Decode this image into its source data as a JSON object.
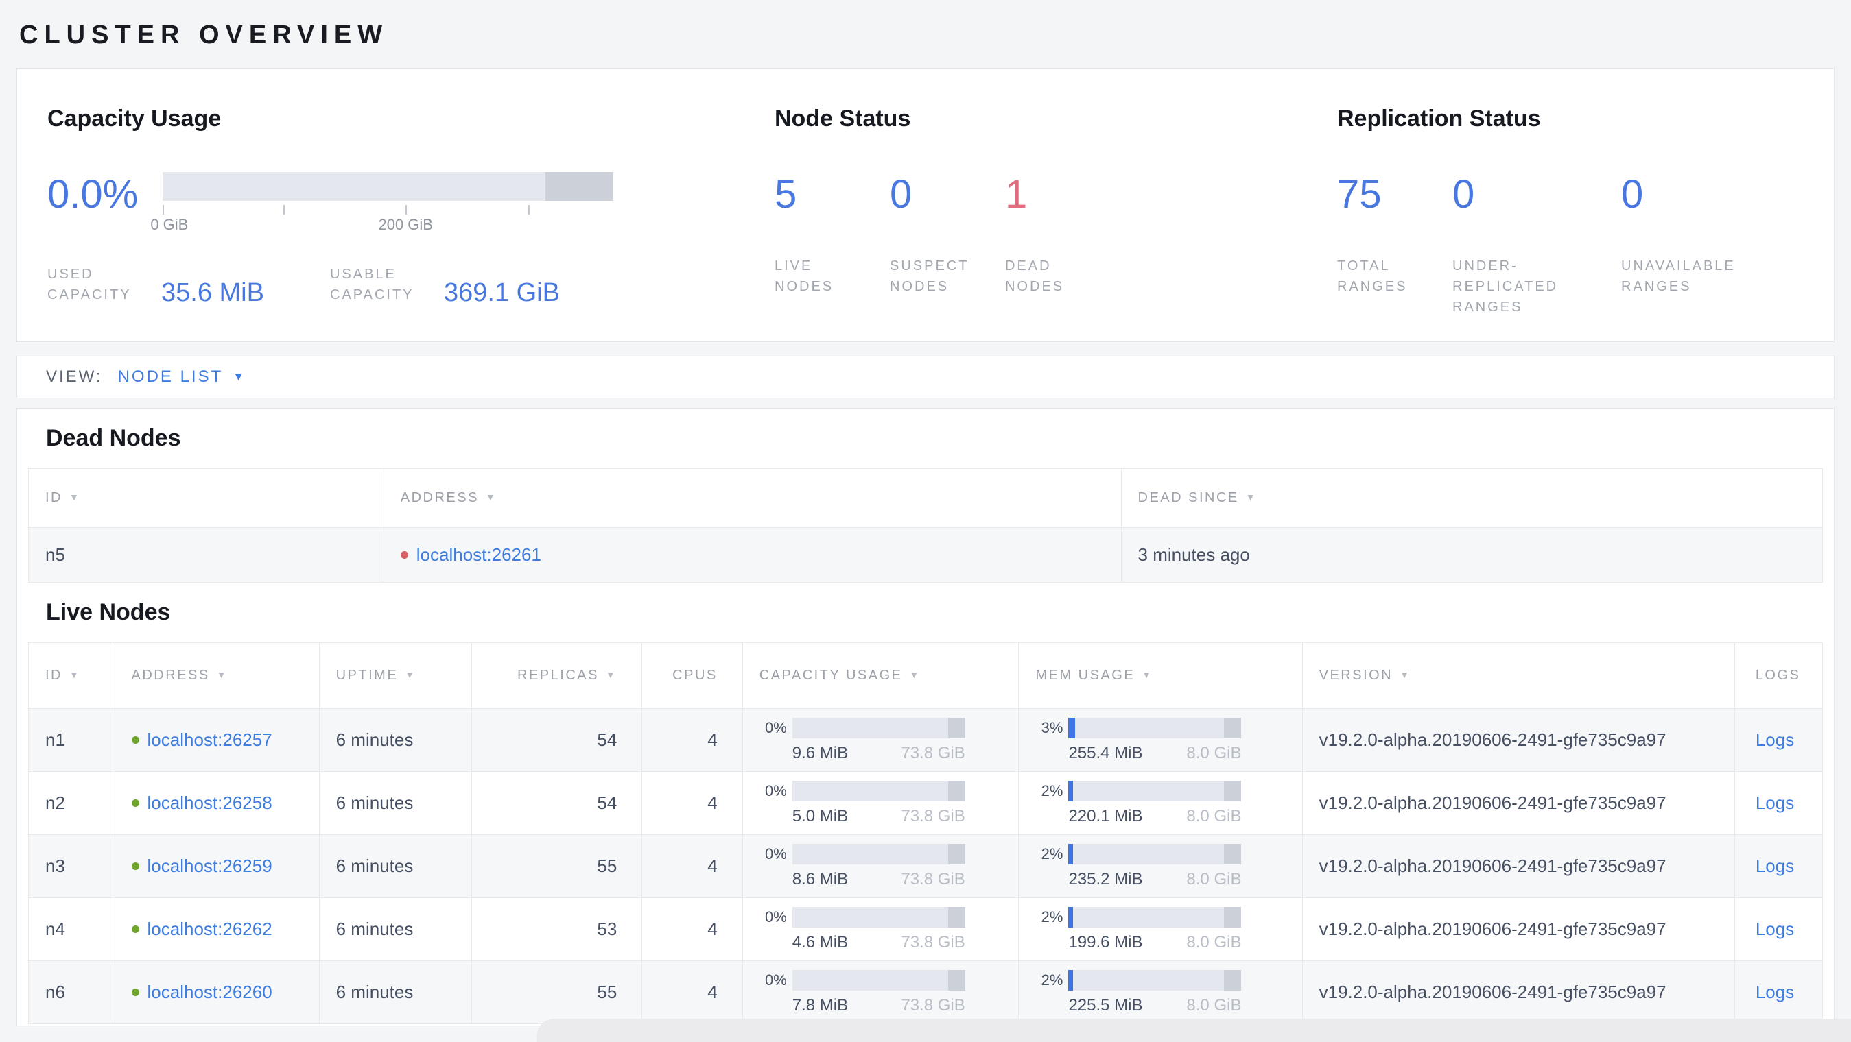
{
  "page": {
    "title": "CLUSTER OVERVIEW"
  },
  "colors": {
    "accent_blue": "#4878df",
    "link_blue": "#3e7ce0",
    "danger_red": "#e06c7d",
    "green_dot": "#6fa42d",
    "red_dot": "#d65d63",
    "bar_track": "#e4e7ed",
    "bar_dark_segment": "#ccd0d9",
    "bar_fill_blue": "#3f74e6"
  },
  "icons": {
    "sort_desc": "▼",
    "caret_down": "▼"
  },
  "summary": {
    "capacity": {
      "title": "Capacity Usage",
      "percent": "0.0%",
      "tick_labels": [
        "0 GiB",
        "200 GiB"
      ],
      "stats": [
        {
          "label": "USED CAPACITY",
          "value": "35.6 MiB"
        },
        {
          "label": "USABLE CAPACITY",
          "value": "369.1 GiB"
        }
      ]
    },
    "node_status": {
      "title": "Node Status",
      "stats": [
        {
          "value": "5",
          "label": "LIVE NODES"
        },
        {
          "value": "0",
          "label": "SUSPECT NODES"
        },
        {
          "value": "1",
          "label": "DEAD NODES"
        }
      ]
    },
    "replication": {
      "title": "Replication Status",
      "stats": [
        {
          "value": "75",
          "label": "TOTAL RANGES"
        },
        {
          "value": "0",
          "label": "UNDER-REPLICATED RANGES"
        },
        {
          "value": "0",
          "label": "UNAVAILABLE RANGES"
        }
      ]
    }
  },
  "view_bar": {
    "label": "VIEW:",
    "selected": "NODE LIST"
  },
  "dead_nodes": {
    "title": "Dead Nodes",
    "columns": [
      {
        "label": "ID"
      },
      {
        "label": "ADDRESS"
      },
      {
        "label": "DEAD SINCE"
      }
    ],
    "rows": [
      {
        "id": "n5",
        "address": "localhost:26261",
        "dead_since": "3 minutes ago"
      }
    ]
  },
  "live_nodes": {
    "title": "Live Nodes",
    "columns": [
      {
        "label": "ID"
      },
      {
        "label": "ADDRESS"
      },
      {
        "label": "UPTIME"
      },
      {
        "label": "REPLICAS"
      },
      {
        "label": "CPUS"
      },
      {
        "label": "CAPACITY USAGE"
      },
      {
        "label": "MEM USAGE"
      },
      {
        "label": "VERSION"
      },
      {
        "label": "LOGS"
      }
    ],
    "rows": [
      {
        "id": "n1",
        "address": "localhost:26257",
        "uptime": "6 minutes",
        "replicas": "54",
        "cpus": "4",
        "cap": {
          "pct": "0%",
          "used": "9.6 MiB",
          "total": "73.8 GiB"
        },
        "mem": {
          "pct": "3%",
          "used": "255.4 MiB",
          "total": "8.0 GiB"
        },
        "version": "v19.2.0-alpha.20190606-2491-gfe735c9a97",
        "logs_label": "Logs"
      },
      {
        "id": "n2",
        "address": "localhost:26258",
        "uptime": "6 minutes",
        "replicas": "54",
        "cpus": "4",
        "cap": {
          "pct": "0%",
          "used": "5.0 MiB",
          "total": "73.8 GiB"
        },
        "mem": {
          "pct": "2%",
          "used": "220.1 MiB",
          "total": "8.0 GiB"
        },
        "version": "v19.2.0-alpha.20190606-2491-gfe735c9a97",
        "logs_label": "Logs"
      },
      {
        "id": "n3",
        "address": "localhost:26259",
        "uptime": "6 minutes",
        "replicas": "55",
        "cpus": "4",
        "cap": {
          "pct": "0%",
          "used": "8.6 MiB",
          "total": "73.8 GiB"
        },
        "mem": {
          "pct": "2%",
          "used": "235.2 MiB",
          "total": "8.0 GiB"
        },
        "version": "v19.2.0-alpha.20190606-2491-gfe735c9a97",
        "logs_label": "Logs"
      },
      {
        "id": "n4",
        "address": "localhost:26262",
        "uptime": "6 minutes",
        "replicas": "53",
        "cpus": "4",
        "cap": {
          "pct": "0%",
          "used": "4.6 MiB",
          "total": "73.8 GiB"
        },
        "mem": {
          "pct": "2%",
          "used": "199.6 MiB",
          "total": "8.0 GiB"
        },
        "version": "v19.2.0-alpha.20190606-2491-gfe735c9a97",
        "logs_label": "Logs"
      },
      {
        "id": "n6",
        "address": "localhost:26260",
        "uptime": "6 minutes",
        "replicas": "55",
        "cpus": "4",
        "cap": {
          "pct": "0%",
          "used": "7.8 MiB",
          "total": "73.8 GiB"
        },
        "mem": {
          "pct": "2%",
          "used": "225.5 MiB",
          "total": "8.0 GiB"
        },
        "version": "v19.2.0-alpha.20190606-2491-gfe735c9a97",
        "logs_label": "Logs"
      }
    ]
  }
}
